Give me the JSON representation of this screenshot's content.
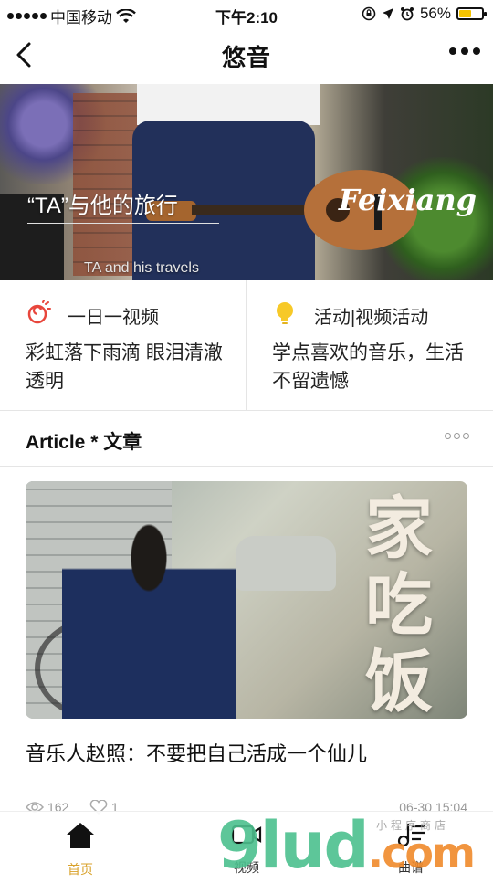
{
  "status_bar": {
    "carrier": "中国移动",
    "time": "下午2:10",
    "battery_percent": "56%",
    "battery_level": 0.56
  },
  "nav": {
    "title": "悠音",
    "back_icon": "chevron-left-icon",
    "more_icon": "more-dots-icon"
  },
  "banner": {
    "caption_main": "“TA”与他的旅行",
    "caption_sub": "TA and his travels",
    "brand": "Feixiang"
  },
  "features": [
    {
      "icon": "daily-video-icon",
      "tag": "一日一视频",
      "desc": "彩虹落下雨滴 眼泪清澈透明",
      "icon_color": "#e8463c"
    },
    {
      "icon": "lightbulb-icon",
      "tag": "活动|视频活动",
      "desc": "学点喜欢的音乐，生活不留遗憾",
      "icon_color": "#f7c928"
    }
  ],
  "article_section": {
    "label": "Article * 文章"
  },
  "article": {
    "image_text": "家吃饭",
    "title": "音乐人赵照：不要把自己活成一个仙儿",
    "views": "162",
    "likes": "1",
    "time": "06-30 15:04"
  },
  "tabbar": {
    "items": [
      {
        "label": "首页",
        "icon": "home-icon",
        "active": true
      },
      {
        "label": "视频",
        "icon": "video-icon",
        "active": false
      },
      {
        "label": "曲谱",
        "icon": "music-score-icon",
        "active": false
      }
    ],
    "active_color": "#d9a22b"
  },
  "watermark": {
    "text": "9lud",
    "suffix": ".com",
    "small": "小程序商店"
  }
}
